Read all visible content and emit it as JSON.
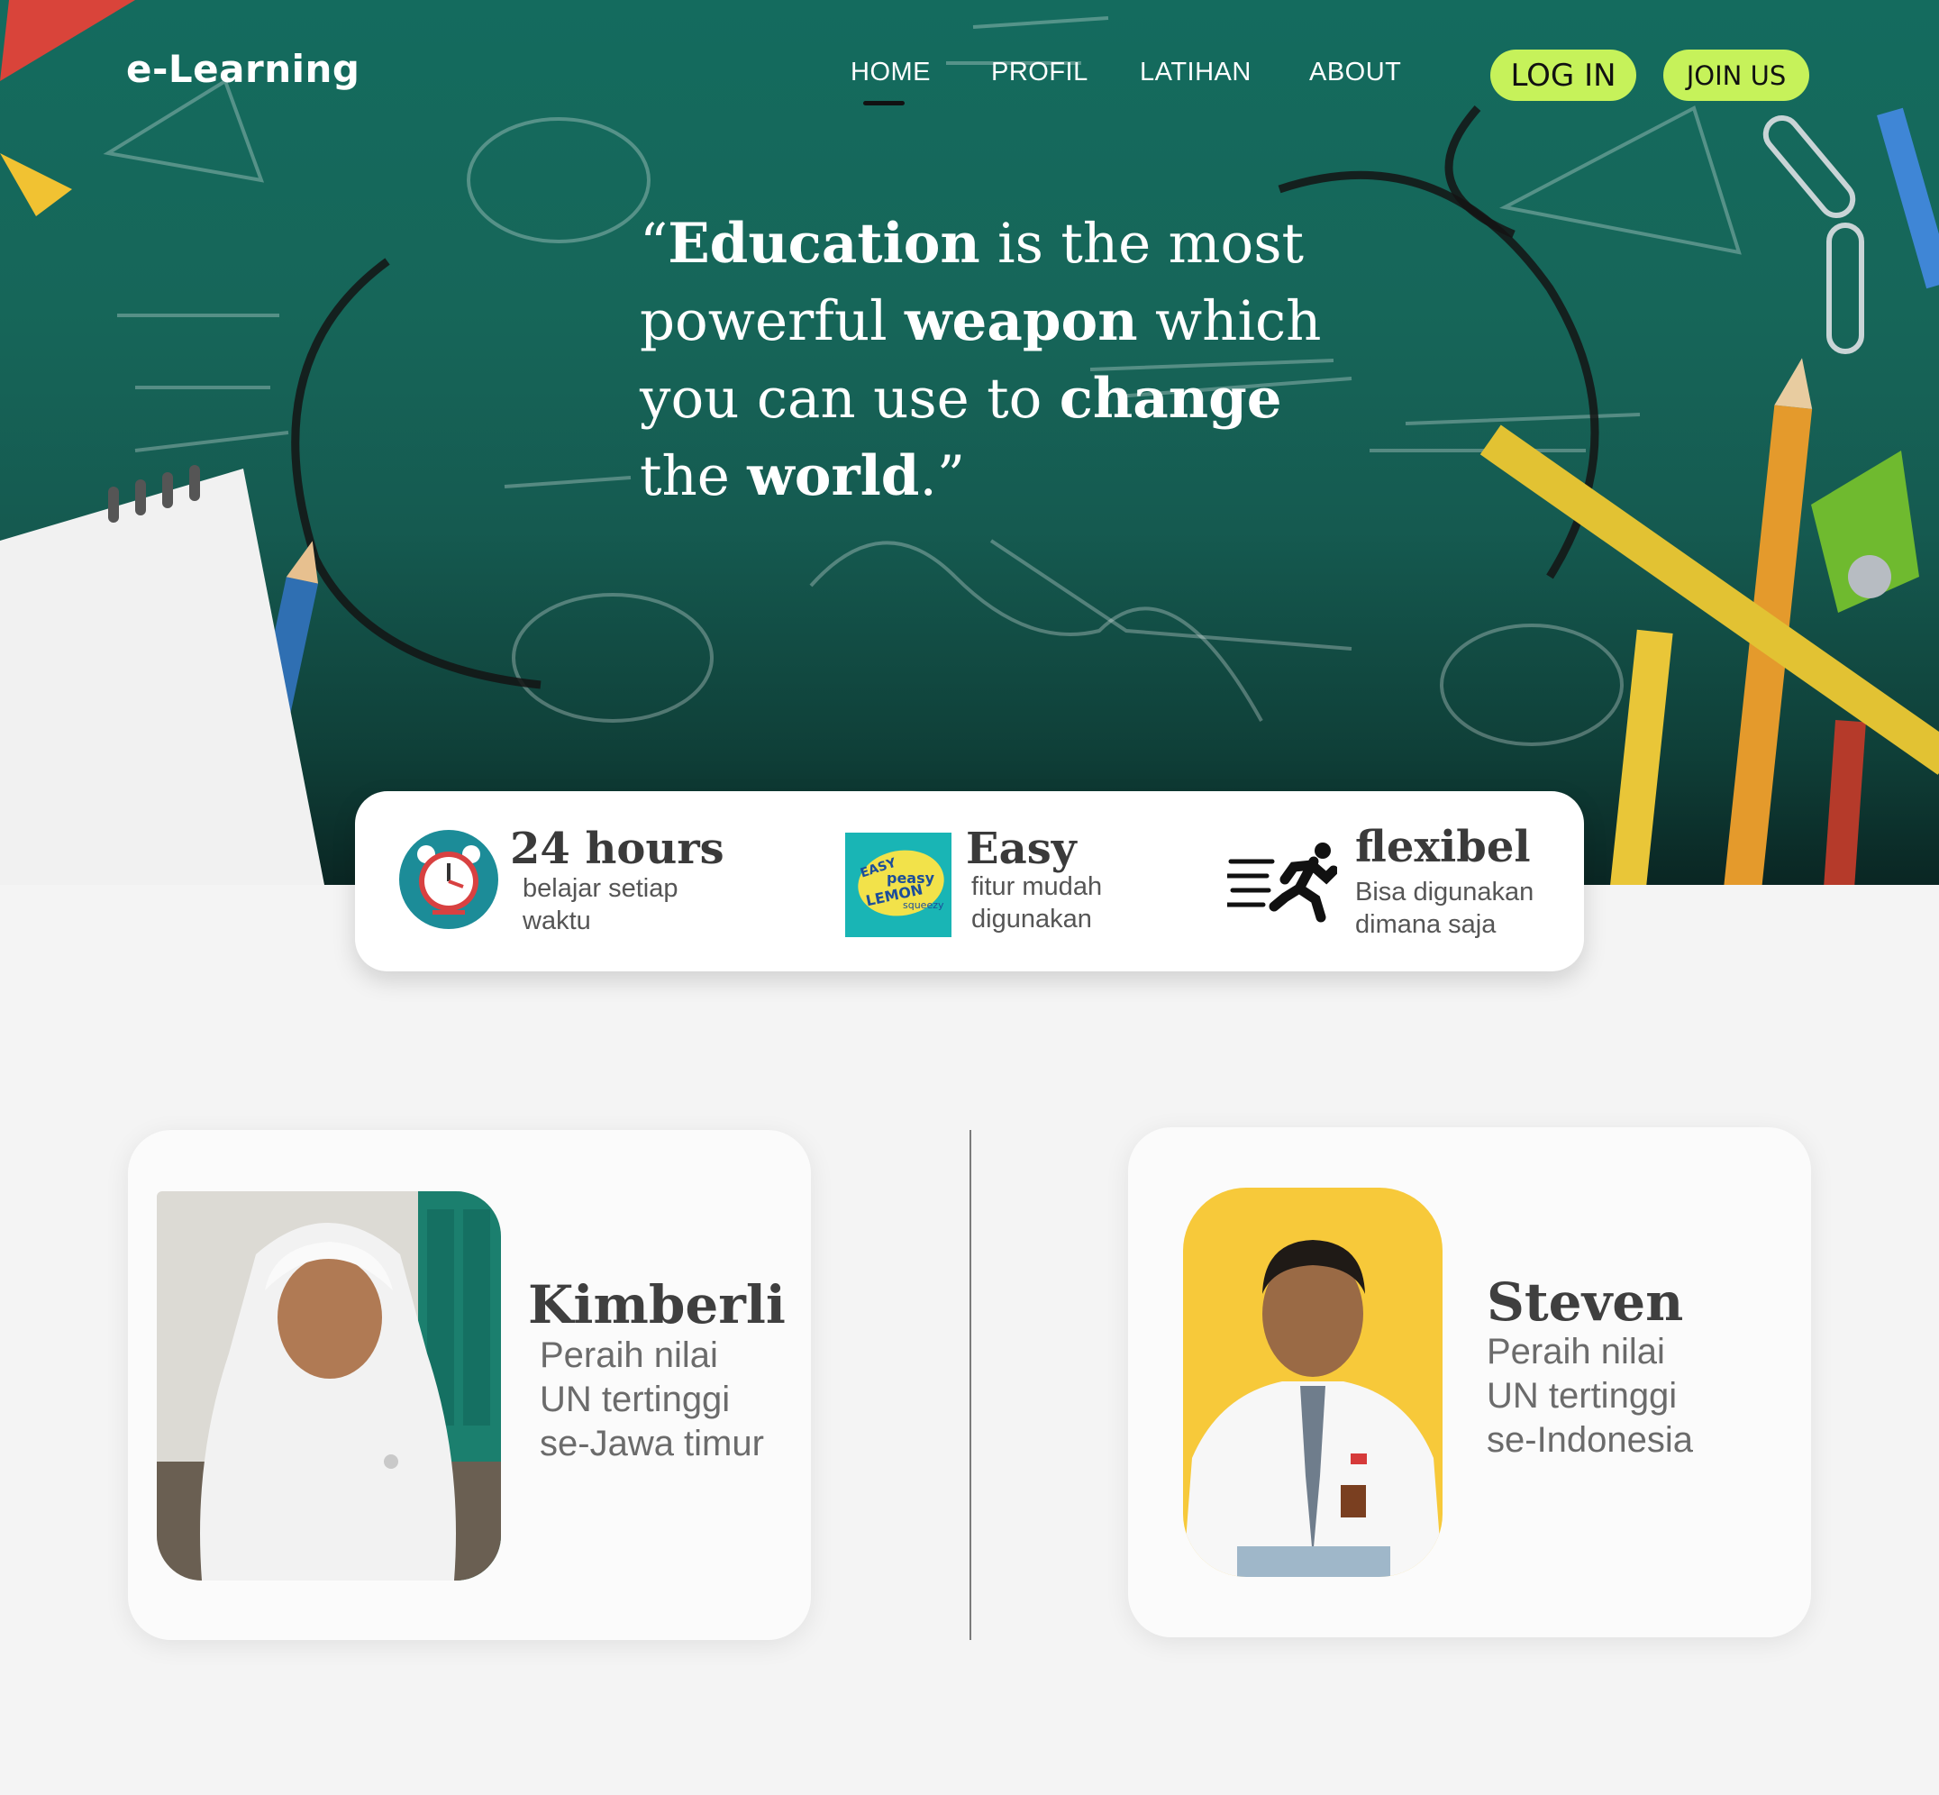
{
  "brand": "e-Learning",
  "nav": {
    "home": "HOME",
    "profil": "PROFIL",
    "latihan": "LATIHAN",
    "about": "ABOUT",
    "login": "LOG IN",
    "join": "JOIN US"
  },
  "quote": {
    "l1a": "“",
    "l1b": "Education",
    "l1c": " is the most",
    "l2a": "powerful ",
    "l2b": "weapon",
    "l2c": " which",
    "l3a": " you can use to ",
    "l3b": "change",
    "l4a": "the ",
    "l4b": "world",
    "l4c": ".”"
  },
  "features": [
    {
      "title": "24 hours",
      "desc1": "belajar setiap",
      "desc2": "waktu",
      "icon": "alarm-clock-icon"
    },
    {
      "title": "Easy",
      "desc1": "fitur mudah",
      "desc2": "digunakan",
      "icon": "easy-peasy-lemon-squeezy-badge"
    },
    {
      "title": "flexibel",
      "desc1": "Bisa digunakan",
      "desc2": "dimana saja",
      "icon": "running-person-icon"
    }
  ],
  "easy_badge": {
    "w1": "EASY",
    "w2": "peasy",
    "w3": "LEMON",
    "w4": "squeezy"
  },
  "students": [
    {
      "name": "Kimberli",
      "line1": "Peraih nilai",
      "line2": "UN tertinggi",
      "line3": "se-Jawa timur"
    },
    {
      "name": "Steven",
      "line1": "Peraih nilai",
      "line2": "UN tertinggi",
      "line3": "se-Indonesia"
    }
  ],
  "colors": {
    "accent": "#c6f25a",
    "hero": "#146b5e",
    "teal_icon": "#1c8c98"
  }
}
